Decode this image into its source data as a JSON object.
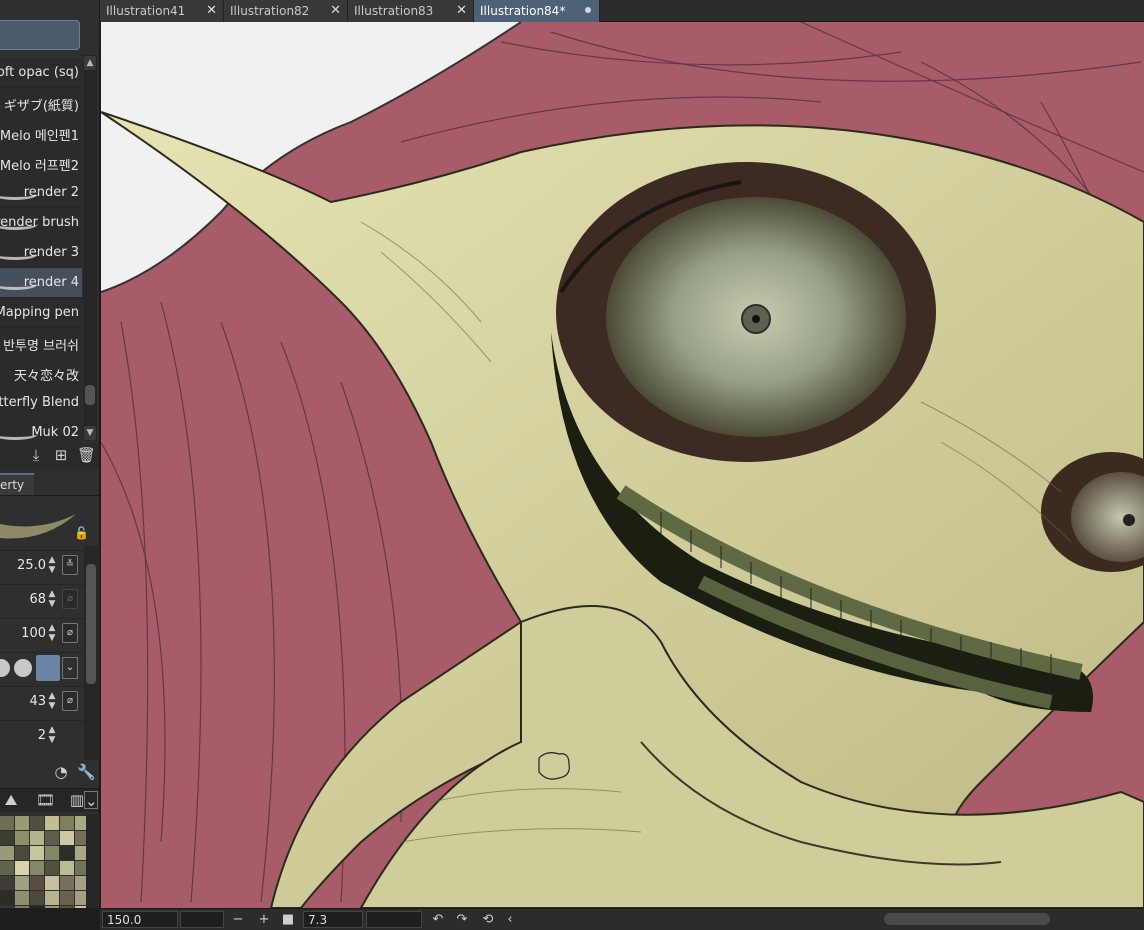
{
  "tabs": [
    {
      "label": "Illustration41"
    },
    {
      "label": "Illustration82"
    },
    {
      "label": "Illustration83"
    },
    {
      "label": "Illustration84*"
    }
  ],
  "brush_list": [
    {
      "label": "soft opac (sq)"
    },
    {
      "label": "ギザブ(紙質)"
    },
    {
      "label": "Melo 메인펜1"
    },
    {
      "label": "Melo 러프펜2"
    },
    {
      "label": "render 2"
    },
    {
      "label": "render brush"
    },
    {
      "label": "render 3"
    },
    {
      "label": "render 4"
    },
    {
      "label": "Mapping pen"
    },
    {
      "label": "다 반투명 브러쉬"
    },
    {
      "label": "天々恋々改"
    },
    {
      "label": "Butterfly Blend"
    },
    {
      "label": "Muk 02"
    }
  ],
  "selected_brush": "render 4",
  "tool_property": {
    "tab_label": "erty",
    "values": [
      "25.0",
      "68",
      "100",
      "43",
      "2"
    ]
  },
  "status_bar": {
    "zoom": "150.0",
    "rotation": "7.3"
  },
  "colors": {
    "accent": "#4f6176",
    "canvas_background": "#a65a68",
    "skin": "#d8d6a0"
  },
  "swatch_colors": [
    "#6b6e52",
    "#9a9b74",
    "#4f5040",
    "#c0bf93",
    "#7d7f5d",
    "#a8a987",
    "#3b3d30",
    "#8e8f69",
    "#b3b48c",
    "#5d5e48",
    "#ccc9a4",
    "#716f5a",
    "#999a7a",
    "#494a39",
    "#c7c59b",
    "#84866a",
    "#2d2f27",
    "#aaa886",
    "#62634c",
    "#d6d3ad",
    "#888866",
    "#50513f",
    "#bcbb96",
    "#737457",
    "#3e3c34",
    "#9fa07e",
    "#5a4d44",
    "#c4c29e",
    "#7a6e5f",
    "#a3a183",
    "#2f2b27",
    "#8f8f70",
    "#4d4a3a",
    "#b5b48f",
    "#67634f",
    "#a49e83",
    "#3a3630",
    "#7f7b63",
    "#26251f",
    "#99957a",
    "#58553f",
    "#c6c4a0"
  ]
}
